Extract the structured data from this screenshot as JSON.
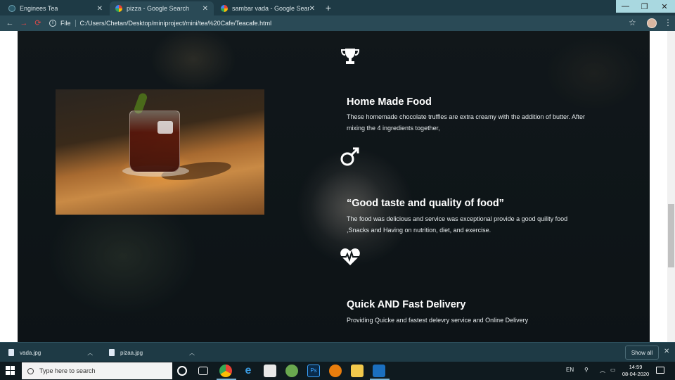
{
  "browser": {
    "tabs": [
      {
        "title": "Enginees Tea",
        "active": false
      },
      {
        "title": "pizza - Google Search",
        "active": true
      },
      {
        "title": "sambar vada - Google Search",
        "active": false
      }
    ],
    "new_tab": "+",
    "window_controls": {
      "minimize": "—",
      "restore": "❐",
      "close": "✕"
    },
    "address": {
      "scheme_label": "File",
      "url": "C:/Users/Chetan/Desktop/miniproject/mini/tea%20Cafe/Teacafe.html"
    }
  },
  "page": {
    "features": [
      {
        "icon": "trophy-icon",
        "title": "Home Made Food",
        "text": "These homemade chocolate truffles are extra creamy with the addition of butter. After mixing the 4 ingredients together,"
      },
      {
        "icon": "male-symbol-icon",
        "title": "“Good taste and quality of food”",
        "text": "The food was delicious and service was exceptional provide a good quility food ,Snacks and Having on nutrition, diet, and exercise."
      },
      {
        "icon": "heart-pulse-icon",
        "title": "Quick AND Fast Delivery",
        "text": "Providing Quicke and fastest delevry service and Online Delivery"
      }
    ]
  },
  "downloads": {
    "items": [
      {
        "name": "vada.jpg"
      },
      {
        "name": "pizaa.jpg"
      }
    ],
    "show_all": "Show all",
    "close": "✕"
  },
  "taskbar": {
    "search_placeholder": "Type here to search",
    "language": "EN",
    "time": "14:59",
    "date": "08-04-2020"
  },
  "colors": {
    "tab_bar": "#1e3a45",
    "toolbar": "#2a4a56",
    "page_bg": "#11181b",
    "taskbar": "#0f1a1f"
  }
}
